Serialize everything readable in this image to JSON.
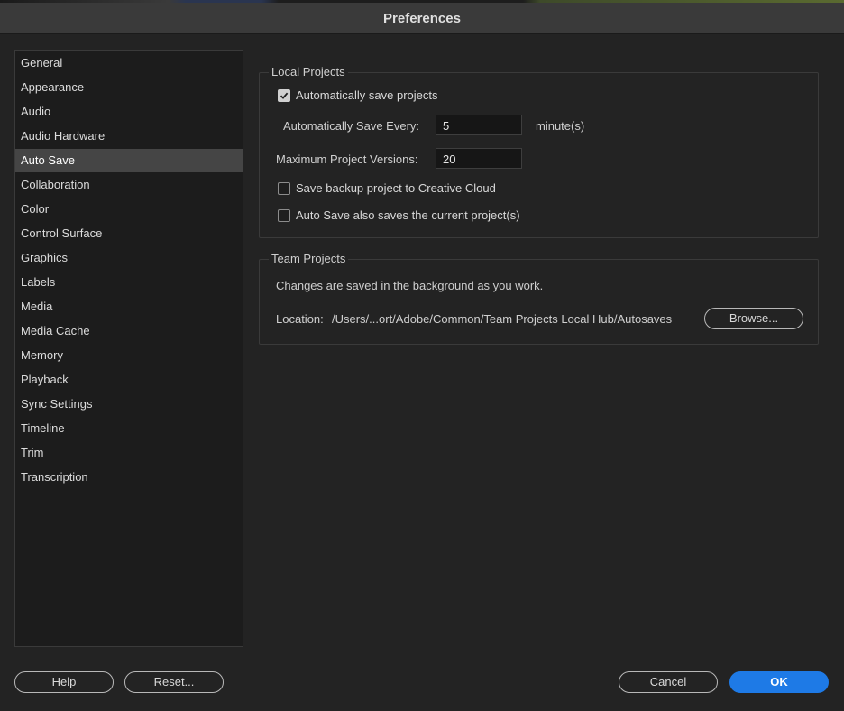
{
  "window": {
    "title": "Preferences"
  },
  "sidebar": {
    "items": [
      "General",
      "Appearance",
      "Audio",
      "Audio Hardware",
      "Auto Save",
      "Collaboration",
      "Color",
      "Control Surface",
      "Graphics",
      "Labels",
      "Media",
      "Media Cache",
      "Memory",
      "Playback",
      "Sync Settings",
      "Timeline",
      "Trim",
      "Transcription"
    ],
    "selected": "Auto Save"
  },
  "local_projects": {
    "title": "Local Projects",
    "auto_save_checkbox": {
      "label": "Automatically save projects",
      "checked": true
    },
    "save_every": {
      "label": "Automatically Save Every:",
      "value": "5",
      "unit": "minute(s)"
    },
    "max_versions": {
      "label": "Maximum Project Versions:",
      "value": "20"
    },
    "backup_checkbox": {
      "label": "Save backup project to Creative Cloud",
      "checked": false
    },
    "also_saves_checkbox": {
      "label": "Auto Save also saves the current project(s)",
      "checked": false
    }
  },
  "team_projects": {
    "title": "Team Projects",
    "description": "Changes are saved in the background as you work.",
    "location_label": "Location:",
    "location_path": "/Users/...ort/Adobe/Common/Team Projects Local Hub/Autosaves",
    "browse_label": "Browse..."
  },
  "footer": {
    "help_label": "Help",
    "reset_label": "Reset...",
    "cancel_label": "Cancel",
    "ok_label": "OK"
  },
  "colors": {
    "accent": "#1e7ae6",
    "selected_item": "#454545",
    "background": "#232323"
  }
}
